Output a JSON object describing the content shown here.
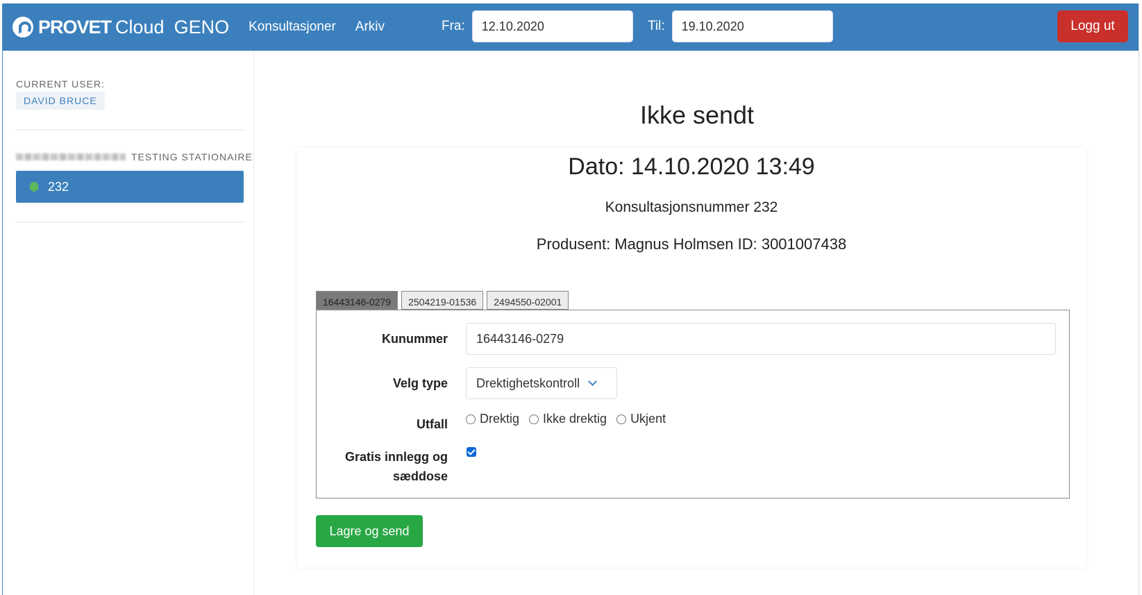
{
  "navbar": {
    "brand_word": "PROVET",
    "brand_cloud": "Cloud",
    "brand_product": "GENO",
    "links": [
      "Konsultasjoner",
      "Arkiv"
    ],
    "from_label": "Fra:",
    "from_value": "12.10.2020",
    "to_label": "Til:",
    "to_value": "19.10.2020",
    "logout_label": "Logg ut"
  },
  "sidebar": {
    "current_user_label": "CURRENT USER:",
    "current_user_name": "DAVID BRUCE",
    "location_suffix": "TESTING STATIONAIRE",
    "consultation_number": "232"
  },
  "main": {
    "title": "Ikke sendt",
    "date_line": "Dato: 14.10.2020 13:49",
    "consultation_line": "Konsultasjonsnummer 232",
    "producer_line": "Produsent: Magnus Holmsen ID: 3001007438",
    "tabs": [
      "16443146-0279",
      "2504219-01536",
      "2494550-02001"
    ],
    "form": {
      "kunummer_label": "Kunummer",
      "kunummer_value": "16443146-0279",
      "type_label": "Velg type",
      "type_value": "Drektighetskontroll",
      "utfall_label": "Utfall",
      "utfall_options": [
        "Drektig",
        "Ikke drektig",
        "Ukjent"
      ],
      "gratis_label_line1": "Gratis innlegg og",
      "gratis_label_line2": "sæddose",
      "gratis_checked": true
    },
    "save_label": "Lagre og send"
  },
  "colors": {
    "navbar": "#3b80bd",
    "logout": "#c9302c",
    "save": "#28a745",
    "bell": "#5cb85c"
  }
}
